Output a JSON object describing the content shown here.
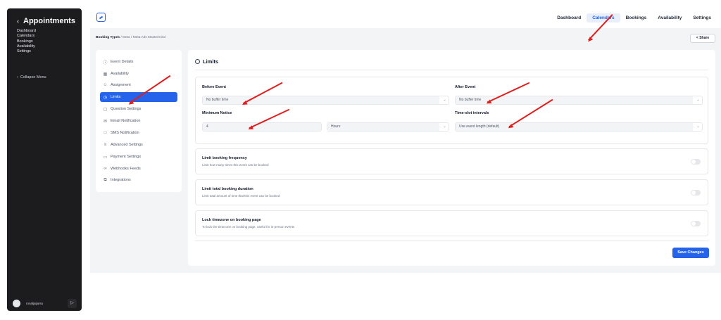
{
  "sidebar": {
    "title": "Appointments",
    "nav": [
      "Dashboard",
      "Calendars",
      "Bookings",
      "Availability",
      "Settings"
    ],
    "collapse_label": "Collapse Menu",
    "username": "ronaljaijarso"
  },
  "topnav": {
    "items": [
      "Dashboard",
      "Calendars",
      "Bookings",
      "Availability",
      "Settings"
    ],
    "active": "Calendars"
  },
  "breadcrumb": {
    "root": "Booking Types",
    "rest": " / Meta / Meta Ads Mastermind"
  },
  "share_label": "Share",
  "left_menu": [
    {
      "label": "Event Details",
      "icon": "info-icon"
    },
    {
      "label": "Availability",
      "icon": "calendar-icon"
    },
    {
      "label": "Assignment",
      "icon": "users-icon"
    },
    {
      "label": "Limits",
      "icon": "clock-icon",
      "active": true
    },
    {
      "label": "Question Settings",
      "icon": "question-icon"
    },
    {
      "label": "Email Notification",
      "icon": "mail-icon"
    },
    {
      "label": "SMS Notification",
      "icon": "message-icon"
    },
    {
      "label": "Advanced Settings",
      "icon": "sliders-icon"
    },
    {
      "label": "Payment Settings",
      "icon": "card-icon"
    },
    {
      "label": "Webhooks Feeds",
      "icon": "link-icon"
    },
    {
      "label": "Integrations",
      "icon": "layers-icon"
    }
  ],
  "panel": {
    "title": "Limits",
    "before_event": {
      "label": "Before Event",
      "value": "No buffer time"
    },
    "after_event": {
      "label": "After Event",
      "value": "No buffer time"
    },
    "minimum_notice": {
      "label": "Minimum Notice",
      "value": "4",
      "unit": "Hours"
    },
    "slot_intervals": {
      "label": "Time-slot intervals",
      "value": "Use event length (default)"
    },
    "toggles": [
      {
        "title": "Limit booking frequency",
        "desc": "Limit how many times this event can be booked",
        "on": false
      },
      {
        "title": "Limit total booking duration",
        "desc": "Limit total amount of time that this event can be booked",
        "on": false
      },
      {
        "title": "Lock timezone on booking page",
        "desc": "To lock the timezone on booking page, useful for in-person events",
        "on": false
      }
    ],
    "save_label": "Save Changes"
  },
  "colors": {
    "accent": "#2563eb",
    "annotation": "#e11d1d"
  }
}
